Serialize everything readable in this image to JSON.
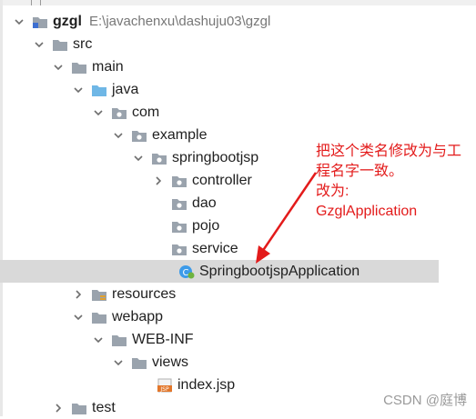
{
  "project": {
    "name": "gzgl",
    "path": "E:\\javachenxu\\dashuju03\\gzgl"
  },
  "tree": {
    "src": "src",
    "main": "main",
    "java": "java",
    "com": "com",
    "example": "example",
    "springbootjsp": "springbootjsp",
    "controller": "controller",
    "dao": "dao",
    "pojo": "pojo",
    "service": "service",
    "app_class": "SpringbootjspApplication",
    "resources": "resources",
    "webapp": "webapp",
    "web_inf": "WEB-INF",
    "views": "views",
    "index_jsp": "index.jsp",
    "test": "test"
  },
  "annotation": {
    "line1": "把这个类名修改为与工",
    "line2": "程名字一致。",
    "line3": "改为:",
    "line4": "GzglApplication"
  },
  "watermark": "CSDN @庭博",
  "colors": {
    "annotation": "#e31b1b",
    "selected_row": "#d9d9d9",
    "folder_gray": "#9aa3ad",
    "java_folder": "#6fb7e6",
    "class_icon": "#3d9be9",
    "spring_badge": "#6db33f"
  }
}
